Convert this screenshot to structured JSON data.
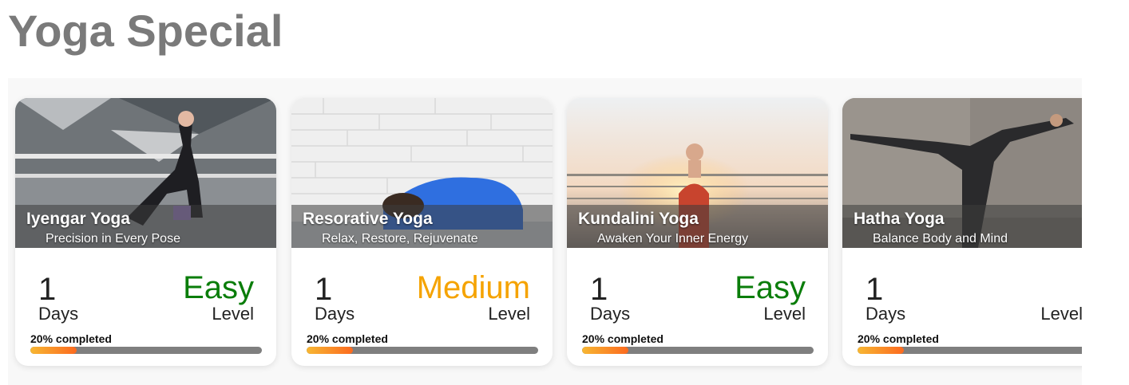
{
  "page": {
    "title": "Yoga Special"
  },
  "cards": [
    {
      "title": "Iyengar Yoga",
      "subtitle": "Precision in Every Pose",
      "days_value": "1",
      "days_label": "Days",
      "level_value": "Easy",
      "level_color": "#0a7d0a",
      "level_label": "Level",
      "progress_text": "20% completed",
      "progress_fraction": 0.2
    },
    {
      "title": "Resorative Yoga",
      "subtitle": "Relax, Restore, Rejuvenate",
      "days_value": "1",
      "days_label": "Days",
      "level_value": "Medium",
      "level_color": "#f5a300",
      "level_label": "Level",
      "progress_text": "20% completed",
      "progress_fraction": 0.2
    },
    {
      "title": "Kundalini Yoga",
      "subtitle": "Awaken Your Inner Energy",
      "days_value": "1",
      "days_label": "Days",
      "level_value": "Easy",
      "level_color": "#0a7d0a",
      "level_label": "Level",
      "progress_text": "20% completed",
      "progress_fraction": 0.2
    },
    {
      "title": "Hatha Yoga",
      "subtitle": "Balance Body and Mind",
      "days_value": "1",
      "days_label": "Days",
      "level_value": "",
      "level_color": "#0a7d0a",
      "level_label": "Level",
      "progress_text": "20% completed",
      "progress_fraction": 0.2
    }
  ],
  "colors": {
    "title_gray": "#7a7a7a",
    "progress_track": "#7f7f7f",
    "progress_start": "#f7b733",
    "progress_end": "#fc6a1f"
  }
}
